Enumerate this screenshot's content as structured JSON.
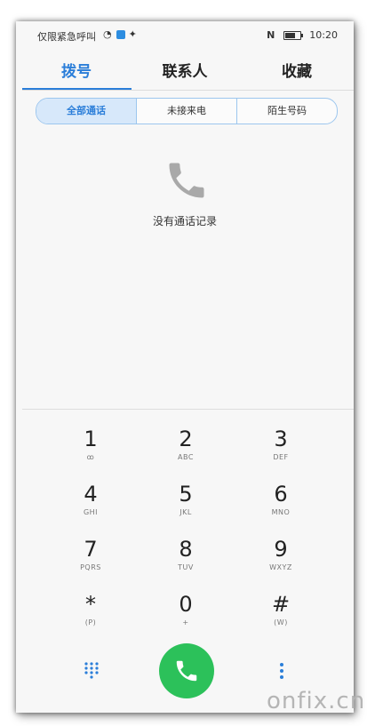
{
  "status_bar": {
    "carrier": "仅限紧急呼叫",
    "time": "10:20",
    "nfc": "N"
  },
  "tabs": [
    {
      "label": "拨号"
    },
    {
      "label": "联系人"
    },
    {
      "label": "收藏"
    }
  ],
  "filters": [
    {
      "label": "全部通话"
    },
    {
      "label": "未接来电"
    },
    {
      "label": "陌生号码"
    }
  ],
  "empty_state": {
    "text": "没有通话记录"
  },
  "keypad": [
    {
      "digit": "1",
      "sub": "ꝏ"
    },
    {
      "digit": "2",
      "sub": "ABC"
    },
    {
      "digit": "3",
      "sub": "DEF"
    },
    {
      "digit": "4",
      "sub": "GHI"
    },
    {
      "digit": "5",
      "sub": "JKL"
    },
    {
      "digit": "6",
      "sub": "MNO"
    },
    {
      "digit": "7",
      "sub": "PQRS"
    },
    {
      "digit": "8",
      "sub": "TUV"
    },
    {
      "digit": "9",
      "sub": "WXYZ"
    },
    {
      "digit": "*",
      "sub": "(P)"
    },
    {
      "digit": "0",
      "sub": "+"
    },
    {
      "digit": "#",
      "sub": "(W)"
    }
  ],
  "colors": {
    "accent": "#2b7ed9",
    "call_button": "#2cc15a"
  },
  "watermark": "onfix.cn"
}
